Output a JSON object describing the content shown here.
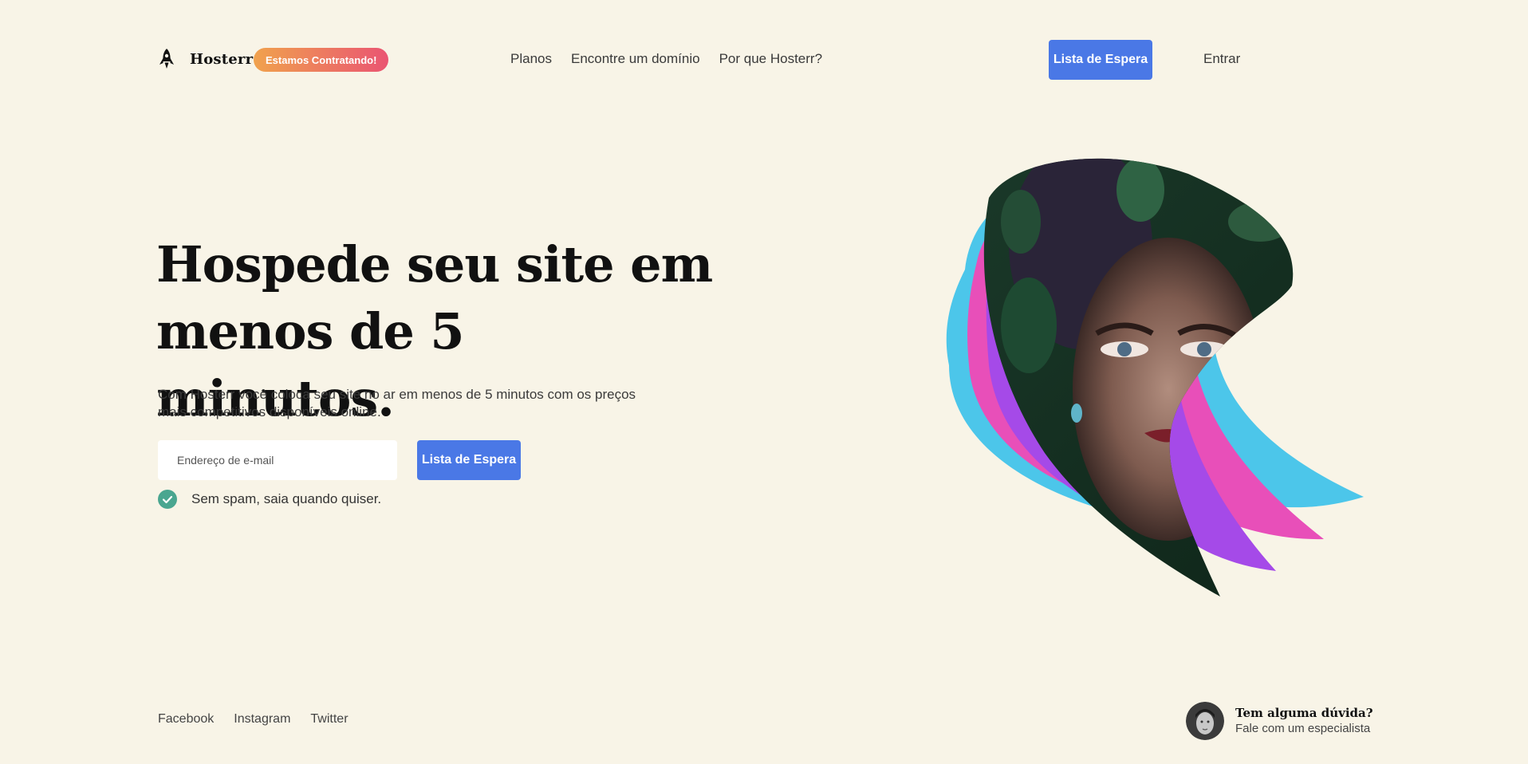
{
  "header": {
    "brand": "Hosterr",
    "hiring_badge": "Estamos Contratando!",
    "nav": [
      {
        "label": "Planos"
      },
      {
        "label": "Encontre um domínio"
      },
      {
        "label": "Por que Hosterr?"
      }
    ],
    "cta_label": "Lista de Espera",
    "login_label": "Entrar"
  },
  "hero": {
    "title_line1": "Hospede seu site em",
    "title_line2": "menos de 5 minutos.",
    "description": "Com Hosterr você coloca seu site no ar em menos de 5 minutos com os preços mais competitivos disponíveis online.",
    "email_placeholder": "Endereço de e-mail",
    "cta_label": "Lista de Espera",
    "no_spam": "Sem spam, saia quando quiser."
  },
  "footer": {
    "social": [
      {
        "label": "Facebook"
      },
      {
        "label": "Instagram"
      },
      {
        "label": "Twitter"
      }
    ],
    "contact_title": "Tem alguma dúvida?",
    "contact_subtitle": "Fale com um especialista"
  },
  "icons": {
    "logo": "rocket-icon",
    "no_spam": "check-circle-icon",
    "contact": "avatar"
  },
  "colors": {
    "background": "#f8f4e7",
    "primary_button": "#4a78e6",
    "badge_gradient_start": "#f0a24d",
    "badge_gradient_end": "#ea5572",
    "check": "#4aa690",
    "art_cyan": "#4cc6ea",
    "art_pink": "#e84fb9",
    "art_purple": "#a54ae8"
  }
}
